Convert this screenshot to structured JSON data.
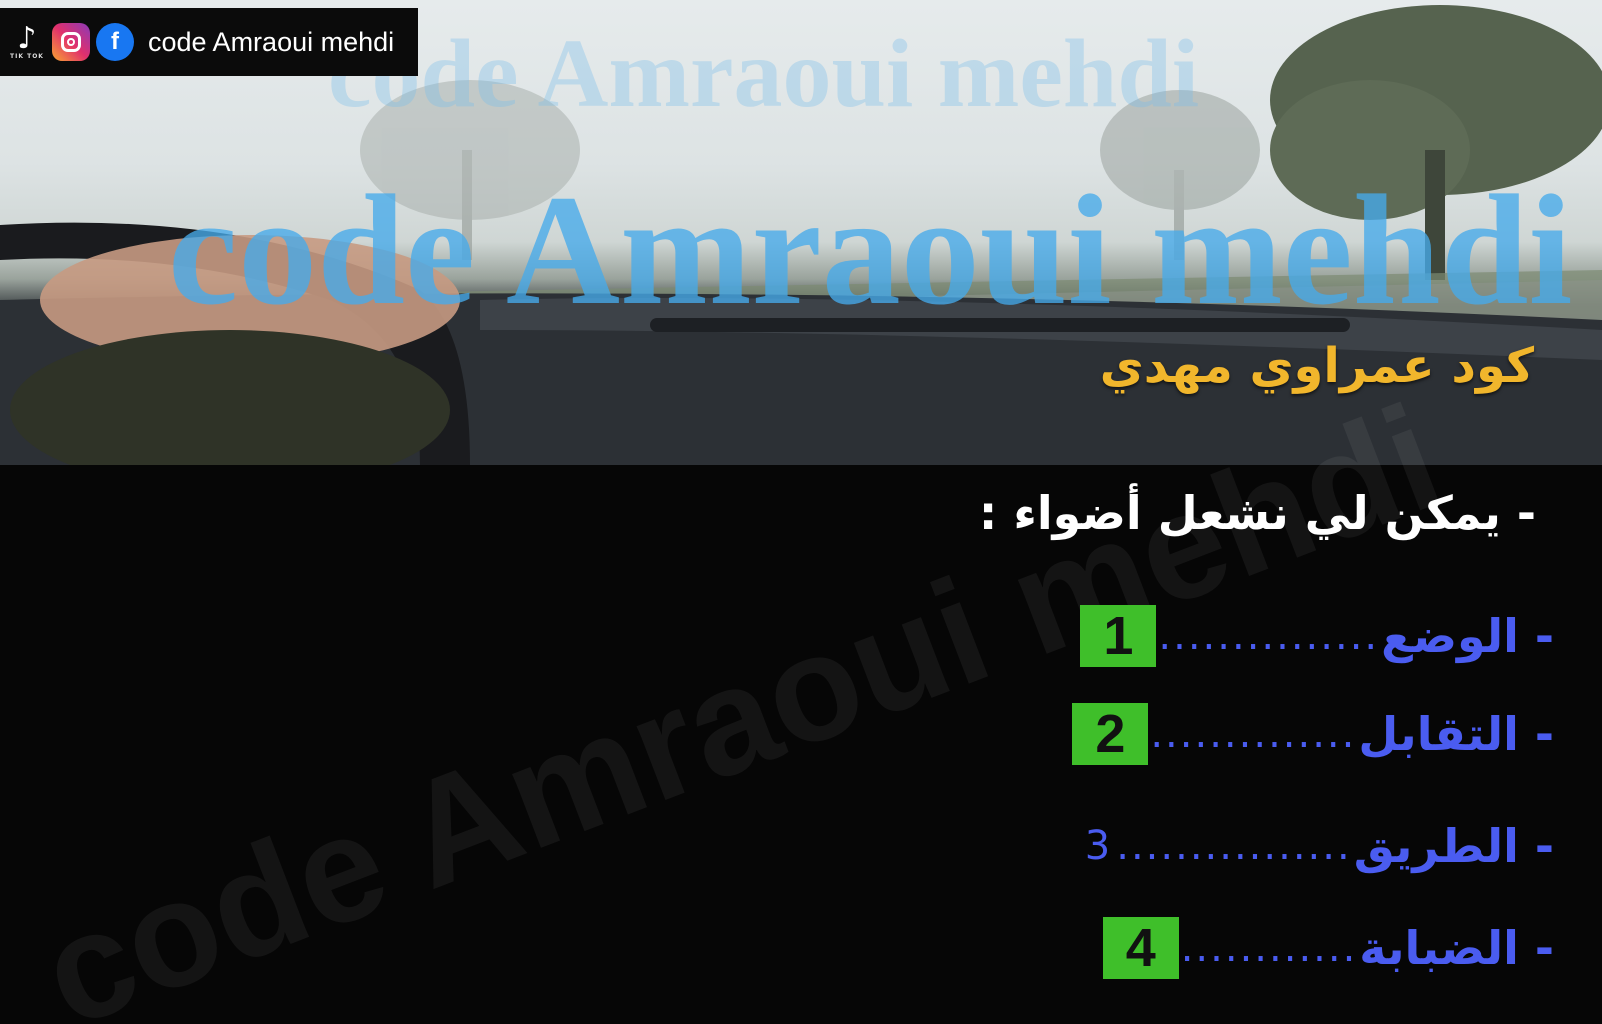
{
  "social": {
    "tiktok_icon_label": "TIK TOK",
    "handle": "code Amraoui mehdi"
  },
  "watermarks": {
    "top": "code Amraoui mehdi",
    "big": "code Amraoui mehdi",
    "diagonal": "code Amraoui mehdi"
  },
  "brand_arabic": "كود عمراوي مهدي",
  "question": "- يمكن لي نشعل أضواء :",
  "options": [
    {
      "label": "- الوضع",
      "dots": "...............",
      "answer": "1",
      "boxed": true
    },
    {
      "label": "- التقابل",
      "dots": "..............",
      "answer": "2",
      "boxed": true
    },
    {
      "label": "- الطريق",
      "dots": "................",
      "answer": "3",
      "boxed": false
    },
    {
      "label": "- الضبابة",
      "dots": "............",
      "answer": "4",
      "boxed": true
    }
  ],
  "colors": {
    "answer_box": "#3fbf2a",
    "option_text": "#4a5cf0",
    "brand_arabic": "#f1b62c",
    "watermark": "#46aaeb"
  }
}
